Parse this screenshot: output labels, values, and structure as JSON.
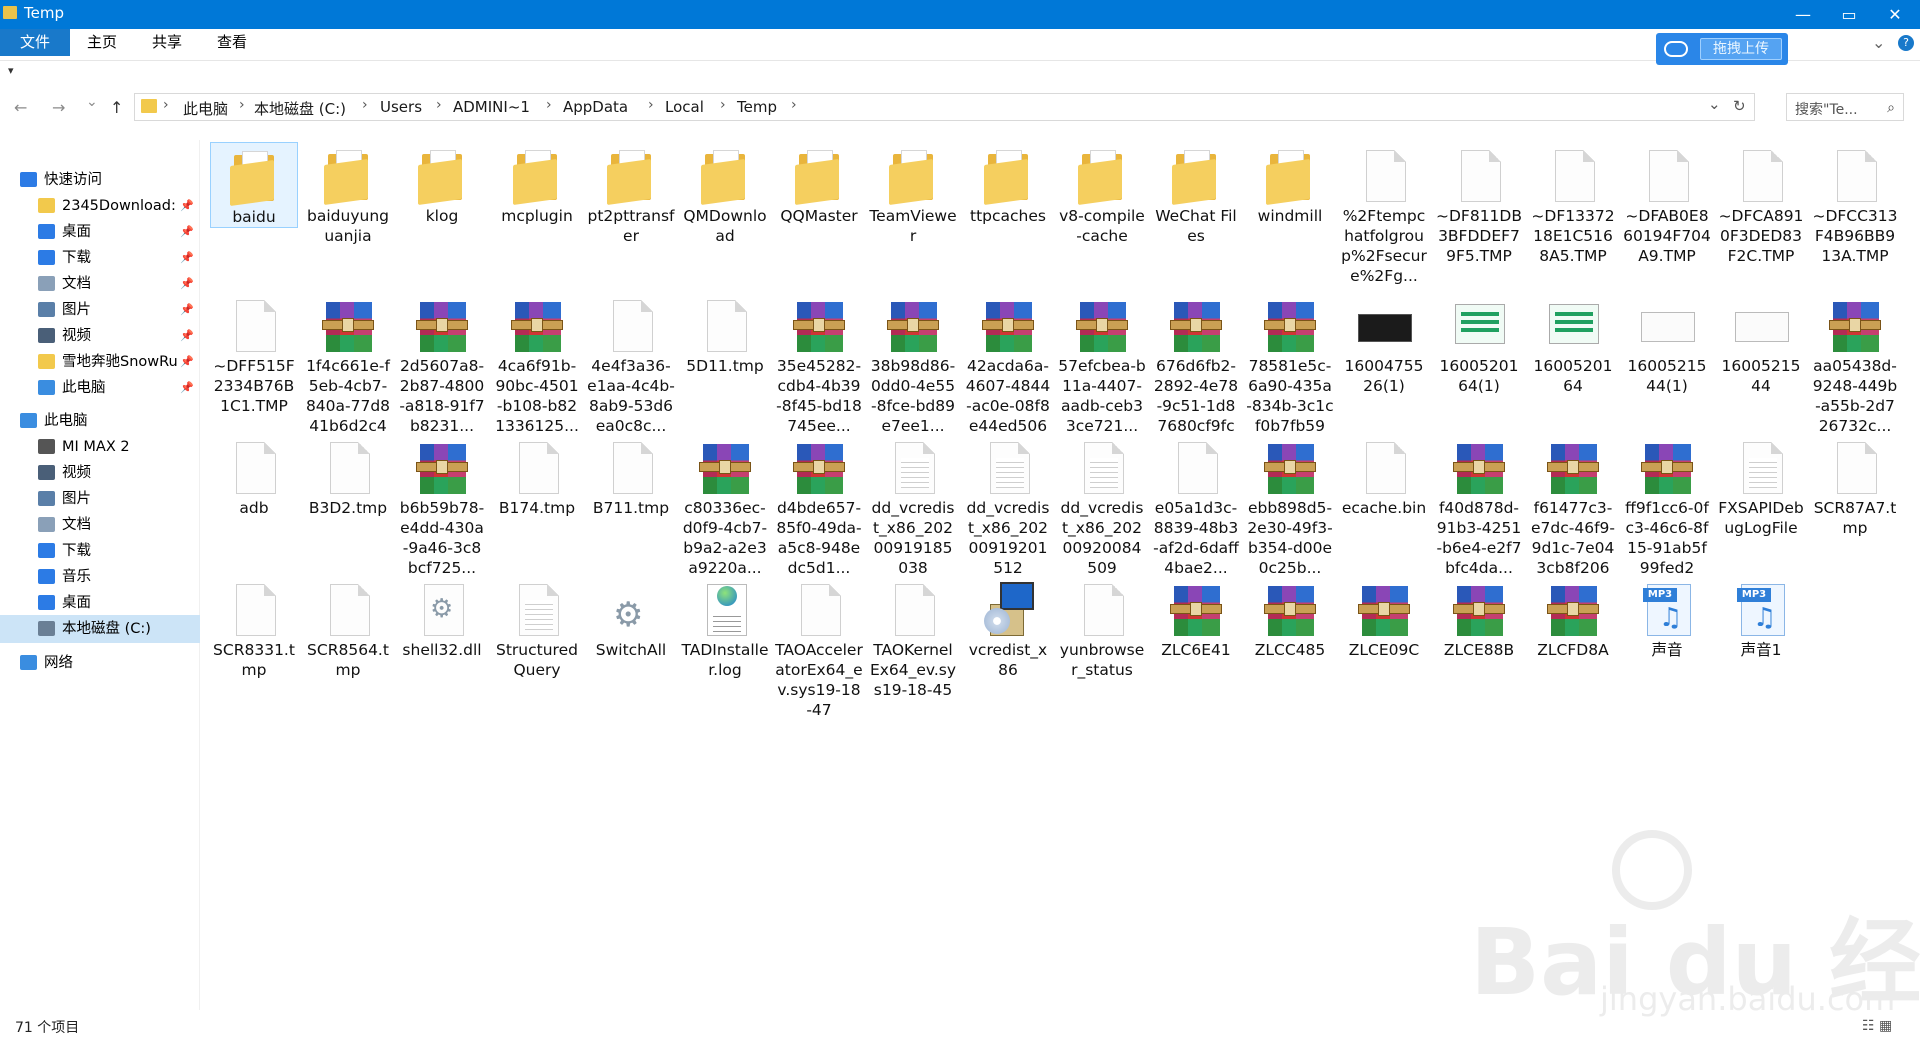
{
  "window": {
    "title": "Temp",
    "minimize": "—",
    "maximize": "▭",
    "close": "✕"
  },
  "ribbon": {
    "tabs": [
      "文件",
      "主页",
      "共享",
      "查看"
    ],
    "upload_button": "拖拽上传",
    "expand_icon": "chevron-down-icon",
    "help_icon": "help-icon"
  },
  "quick_access_toolbar": "▾",
  "nav": {
    "back": "←",
    "forward": "→",
    "recent": "⌄",
    "up": "↑",
    "breadcrumb": [
      "此电脑",
      "本地磁盘 (C:)",
      "Users",
      "ADMINI~1",
      "AppData",
      "Local",
      "Temp"
    ],
    "separator": "›",
    "dropdown": "⌄",
    "refresh": "↻",
    "search_placeholder": "搜索\"Te...",
    "search_icon": "⌕"
  },
  "sidebar": {
    "pin": "📌",
    "items": [
      {
        "label": "快速访问",
        "icon": "star-icon",
        "color": "#2c7be5"
      },
      {
        "label": "2345Download:",
        "icon": "folder-icon",
        "color": "#f2c94c",
        "pinned": true
      },
      {
        "label": "桌面",
        "icon": "desktop-icon",
        "color": "#2c7be5",
        "pinned": true
      },
      {
        "label": "下载",
        "icon": "download-icon",
        "color": "#2c7be5",
        "pinned": true
      },
      {
        "label": "文档",
        "icon": "document-icon",
        "color": "#8aa0b8",
        "pinned": true
      },
      {
        "label": "图片",
        "icon": "picture-icon",
        "color": "#5a7fa8",
        "pinned": true
      },
      {
        "label": "视频",
        "icon": "video-icon",
        "color": "#4a5f78",
        "pinned": true
      },
      {
        "label": "雪地奔驰SnowRu",
        "icon": "folder-icon",
        "color": "#f2c94c",
        "pinned": true
      },
      {
        "label": "此电脑",
        "icon": "computer-icon",
        "color": "#3a8de0",
        "pinned": true
      },
      {
        "label": "此电脑",
        "icon": "computer-icon",
        "color": "#3a8de0"
      },
      {
        "label": "MI MAX 2",
        "icon": "phone-icon",
        "color": "#555555"
      },
      {
        "label": "视频",
        "icon": "video-icon",
        "color": "#4a5f78"
      },
      {
        "label": "图片",
        "icon": "picture-icon",
        "color": "#5a7fa8"
      },
      {
        "label": "文档",
        "icon": "document-icon",
        "color": "#8aa0b8"
      },
      {
        "label": "下载",
        "icon": "download-icon",
        "color": "#2c7be5"
      },
      {
        "label": "音乐",
        "icon": "music-icon",
        "color": "#2c7be5"
      },
      {
        "label": "桌面",
        "icon": "desktop-icon",
        "color": "#2c7be5"
      },
      {
        "label": "本地磁盘 (C:)",
        "icon": "drive-icon",
        "color": "#6a7f95",
        "selected": true
      },
      {
        "label": "网络",
        "icon": "network-icon",
        "color": "#3a8de0"
      }
    ]
  },
  "files": [
    {
      "name": "baidu",
      "type": "folder",
      "selected": true
    },
    {
      "name": "baiduyunguanjia",
      "type": "folder"
    },
    {
      "name": "klog",
      "type": "folder"
    },
    {
      "name": "mcplugin",
      "type": "folder"
    },
    {
      "name": "pt2pttransfer",
      "type": "folder"
    },
    {
      "name": "QMDownload",
      "type": "folder"
    },
    {
      "name": "QQMaster",
      "type": "folder"
    },
    {
      "name": "TeamViewer",
      "type": "folder"
    },
    {
      "name": "ttpcaches",
      "type": "folder"
    },
    {
      "name": "v8-compile-cache",
      "type": "folder"
    },
    {
      "name": "WeChat Files",
      "type": "folder"
    },
    {
      "name": "windmill",
      "type": "folder"
    },
    {
      "name": "%2Ftempchatfolgroup%2Fsecure%2Fg...",
      "type": "doc"
    },
    {
      "name": "~DF811DB3BFDDEF79F5.TMP",
      "type": "doc"
    },
    {
      "name": "~DF1337218E1C5168A5.TMP",
      "type": "doc"
    },
    {
      "name": "~DFAB0E860194F704A9.TMP",
      "type": "doc"
    },
    {
      "name": "~DFCA8910F3DED83F2C.TMP",
      "type": "doc"
    },
    {
      "name": "~DFCC313F4B96BB913A.TMP",
      "type": "doc"
    },
    {
      "name": "~DFF515F2334B76B1C1.TMP",
      "type": "doc"
    },
    {
      "name": "1f4c661e-f5eb-4cb7-840a-77d841b6d2c4",
      "type": "rar"
    },
    {
      "name": "2d5607a8-2b87-4800-a818-91f7b8231...",
      "type": "rar"
    },
    {
      "name": "4ca6f91b-90bc-4501-b108-b821336125...",
      "type": "rar"
    },
    {
      "name": "4e4f3a36-e1aa-4c4b-8ab9-53d6ea0c8c...",
      "type": "doc"
    },
    {
      "name": "5D11.tmp",
      "type": "doc"
    },
    {
      "name": "35e45282-cdb4-4b39-8f45-bd18745ee...",
      "type": "rar"
    },
    {
      "name": "38b98d86-0dd0-4e55-8fce-bd89e7ee1...",
      "type": "rar"
    },
    {
      "name": "42acda6a-4607-4844-ac0e-08f8e44ed506",
      "type": "rar"
    },
    {
      "name": "57efcbea-b11a-4407-aadb-ceb33ce721...",
      "type": "rar"
    },
    {
      "name": "676d6fb2-2892-4e78-9c51-1d87680cf9fc",
      "type": "rar"
    },
    {
      "name": "78581e5c-6a90-435a-834b-3c1cf0b7fb59",
      "type": "rar"
    },
    {
      "name": "1600475526(1)",
      "type": "black"
    },
    {
      "name": "1600520164(1)",
      "type": "thumb"
    },
    {
      "name": "1600520164",
      "type": "thumb"
    },
    {
      "name": "1600521544(1)",
      "type": "thumb2"
    },
    {
      "name": "1600521544",
      "type": "thumb2"
    },
    {
      "name": "aa05438d-9248-449b-a55b-2d726732c...",
      "type": "rar"
    },
    {
      "name": "adb",
      "type": "doc"
    },
    {
      "name": "B3D2.tmp",
      "type": "doc"
    },
    {
      "name": "b6b59b78-e4dd-430a-9a46-3c8bcf725...",
      "type": "rar"
    },
    {
      "name": "B174.tmp",
      "type": "doc"
    },
    {
      "name": "B711.tmp",
      "type": "doc"
    },
    {
      "name": "c80336ec-d0f9-4cb7-b9a2-a2e3a9220a...",
      "type": "rar"
    },
    {
      "name": "d4bde657-85f0-49da-a5c8-948edc5d1...",
      "type": "rar"
    },
    {
      "name": "dd_vcredist_x86_20200919185038",
      "type": "text"
    },
    {
      "name": "dd_vcredist_x86_20200919201512",
      "type": "text"
    },
    {
      "name": "dd_vcredist_x86_20200920084509",
      "type": "text"
    },
    {
      "name": "e05a1d3c-8839-48b3-af2d-6daff4bae2...",
      "type": "doc"
    },
    {
      "name": "ebb898d5-2e30-49f3-b354-d00e0c25b...",
      "type": "rar"
    },
    {
      "name": "ecache.bin",
      "type": "doc"
    },
    {
      "name": "f40d878d-91b3-4251-b6e4-e2f7bfc4da...",
      "type": "rar"
    },
    {
      "name": "f61477c3-e7dc-46f9-9d1c-7e043cb8f206",
      "type": "rar"
    },
    {
      "name": "ff9f1cc6-0fc3-46c6-8f15-91ab5f99fed2",
      "type": "rar"
    },
    {
      "name": "FXSAPIDebugLogFile",
      "type": "text"
    },
    {
      "name": "SCR87A7.tmp",
      "type": "doc"
    },
    {
      "name": "SCR8331.tmp",
      "type": "doc"
    },
    {
      "name": "SCR8564.tmp",
      "type": "doc"
    },
    {
      "name": "shell32.dll",
      "type": "gear"
    },
    {
      "name": "Structured Query",
      "type": "text"
    },
    {
      "name": "SwitchAll",
      "type": "gearonly"
    },
    {
      "name": "TADInstaller.log",
      "type": "log"
    },
    {
      "name": "TAOAcceleratorEx64_ev.sys19-18-47",
      "type": "doc"
    },
    {
      "name": "TAOKernelEx64_ev.sys19-18-45",
      "type": "doc"
    },
    {
      "name": "vcredist_x86",
      "type": "inst"
    },
    {
      "name": "yunbrowser_status",
      "type": "doc"
    },
    {
      "name": "ZLC6E41",
      "type": "rar"
    },
    {
      "name": "ZLCC485",
      "type": "rar"
    },
    {
      "name": "ZLCE09C",
      "type": "rar"
    },
    {
      "name": "ZLCE88B",
      "type": "rar"
    },
    {
      "name": "ZLCFD8A",
      "type": "rar"
    },
    {
      "name": "声音",
      "type": "mp3"
    },
    {
      "name": "声音1",
      "type": "mp3"
    }
  ],
  "status": {
    "count": "71 个项目",
    "view_icons": "☷ ▦"
  },
  "watermark": {
    "brand": "Bai du 经验",
    "url": "jingyan.baidu.com"
  },
  "colors": {
    "accent": "#0078d7",
    "folder": "#f2c94c"
  }
}
